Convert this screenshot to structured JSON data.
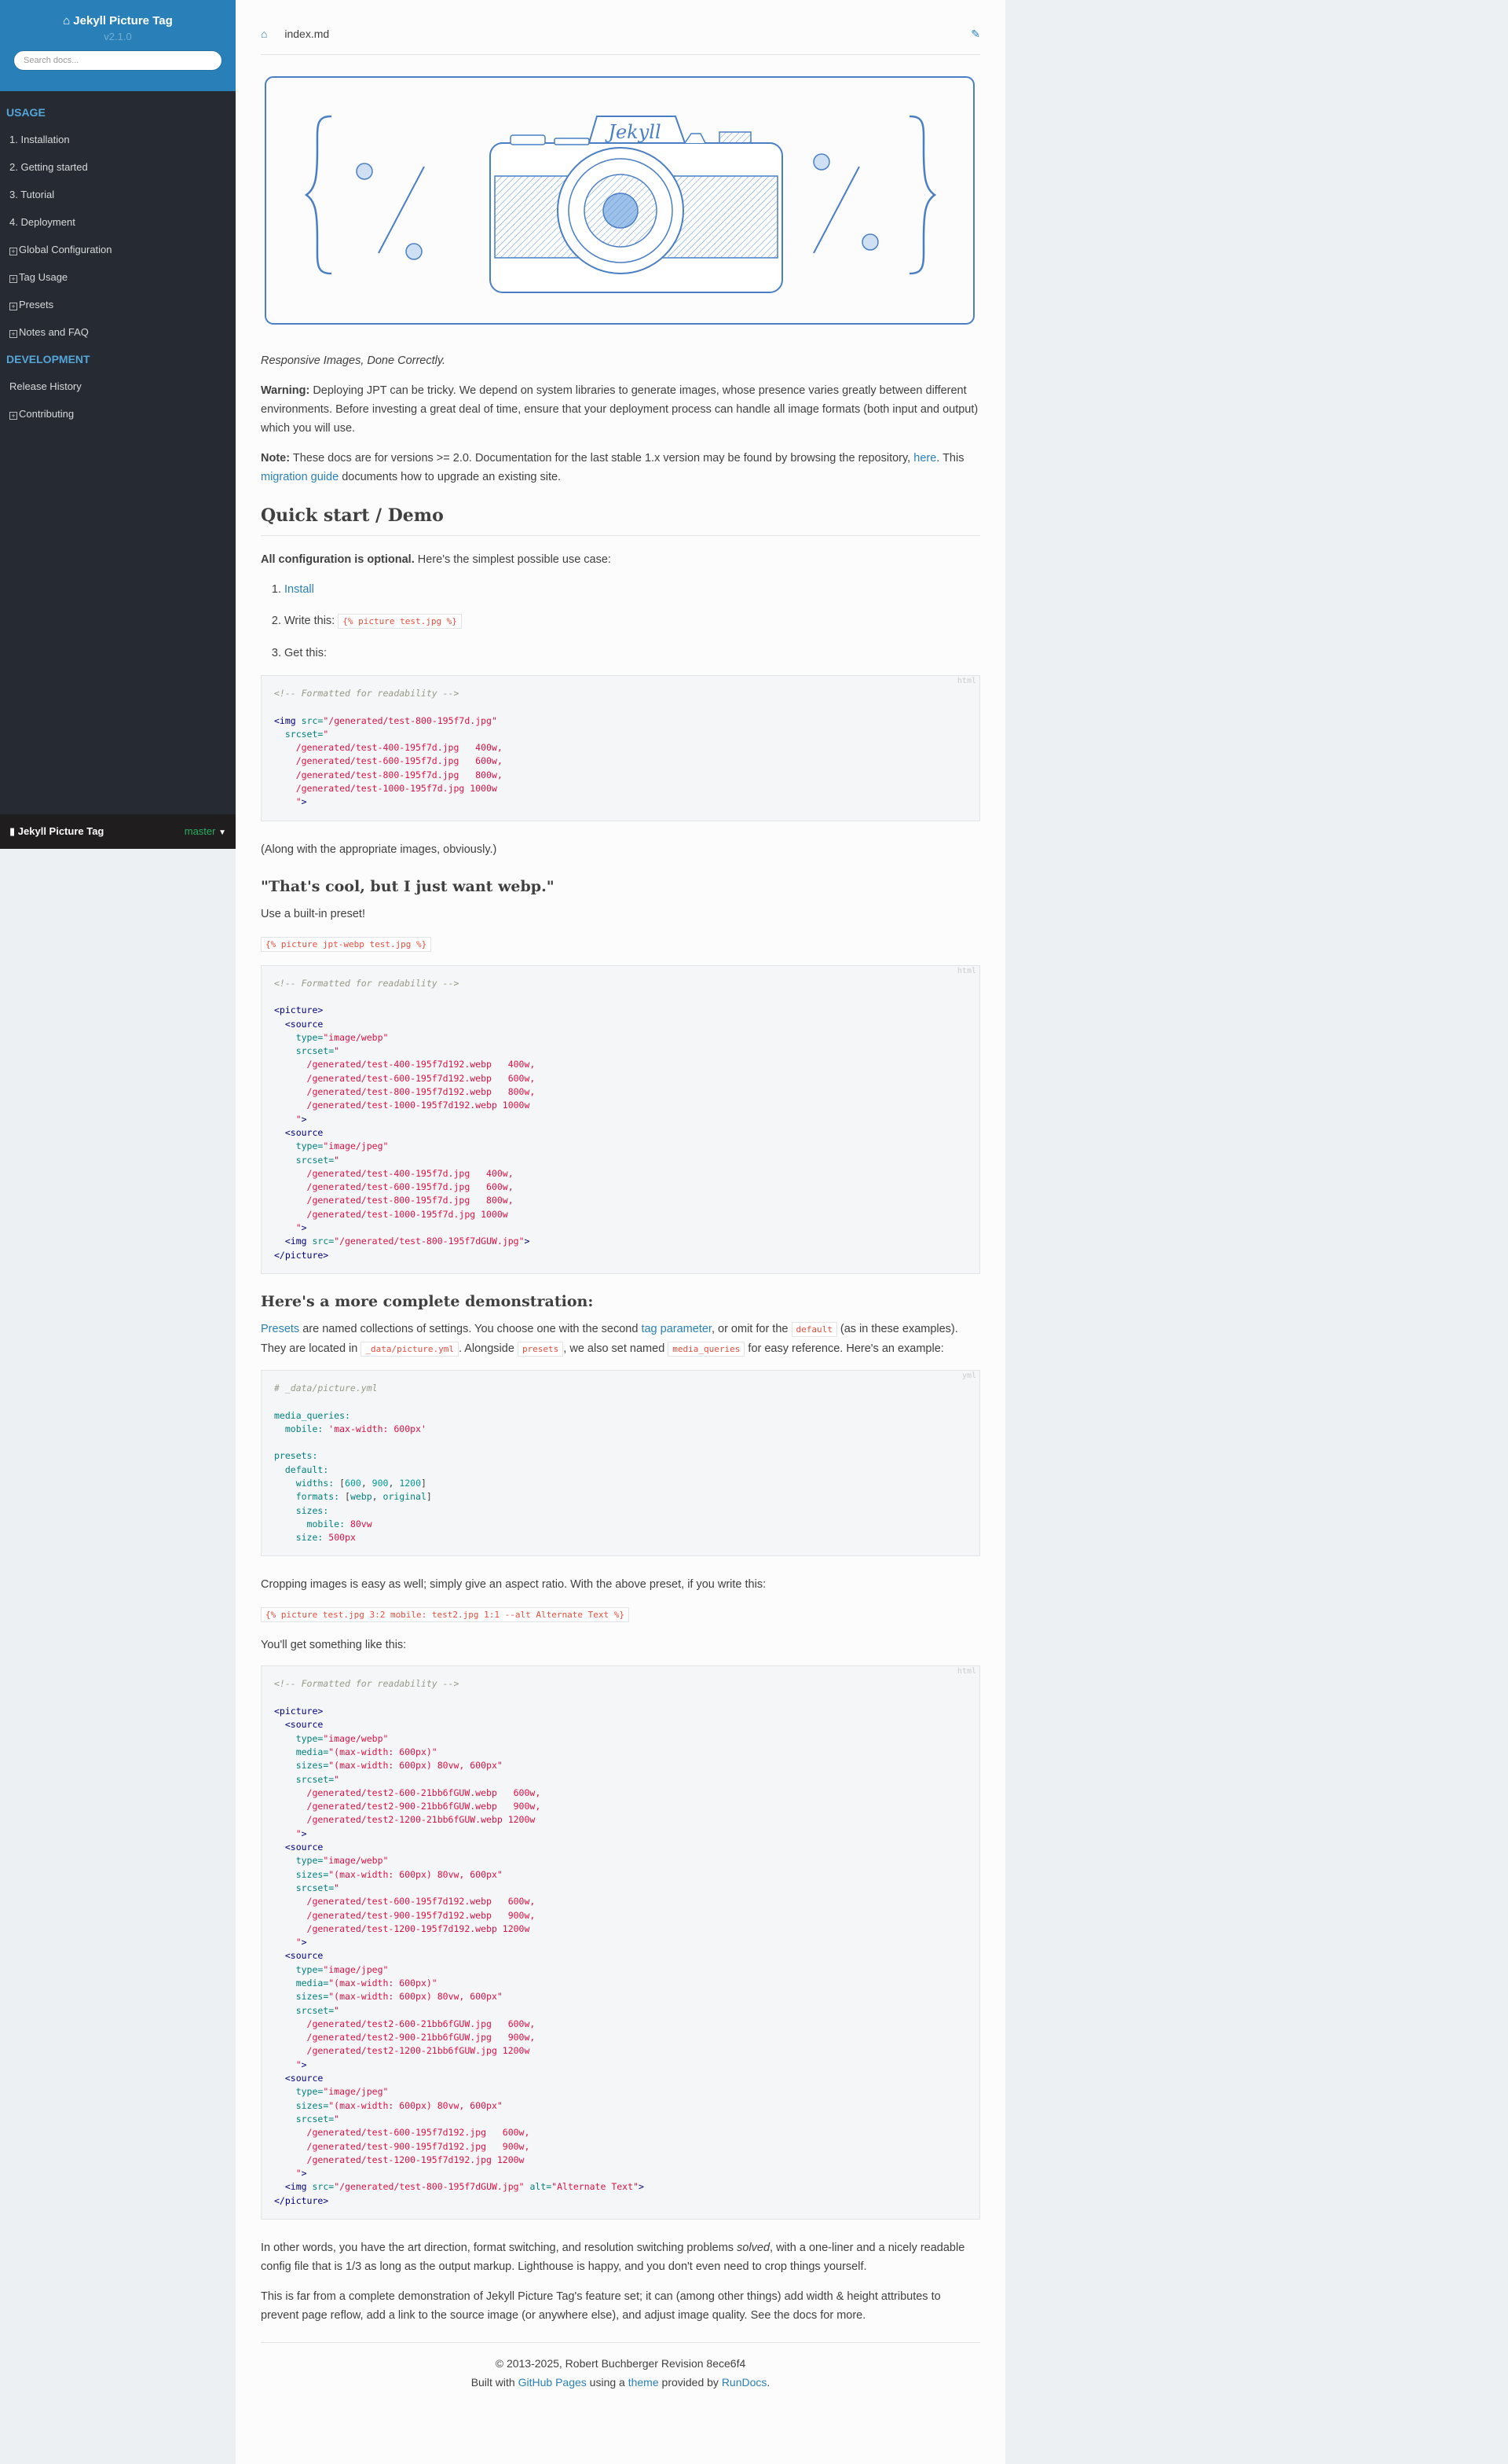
{
  "sidebar": {
    "brand": "Jekyll Picture Tag",
    "version": "v2.1.0",
    "search_placeholder": "Search docs...",
    "caption_usage": "USAGE",
    "usage_items": [
      "1. Installation",
      "2. Getting started",
      "3. Tutorial",
      "4. Deployment"
    ],
    "usage_expandable": [
      "Global Configuration",
      "Tag Usage",
      "Presets",
      "Notes and FAQ"
    ],
    "caption_dev": "DEVELOPMENT",
    "dev_items": [
      "Release History"
    ],
    "dev_expandable": [
      "Contributing"
    ],
    "footer_name": "Jekyll Picture Tag",
    "footer_branch": "master"
  },
  "breadcrumb": {
    "file": "index.md"
  },
  "hero": {
    "label": "Jekyll"
  },
  "intro": {
    "tagline": "Responsive Images, Done Correctly.",
    "warning_label": "Warning:",
    "warning_text": "Deploying JPT can be tricky. We depend on system libraries to generate images, whose presence varies greatly between different environments. Before investing a great deal of time, ensure that your deployment process can handle all image formats (both input and output) which you will use.",
    "note_label": "Note:",
    "note_text": "These docs are for versions >= 2.0. Documentation for the last stable 1.x version may be found by browsing the repository,",
    "note_link": "here",
    "note_text2": ". This",
    "note_link2": "migration guide",
    "note_text3": "documents how to upgrade an existing site."
  },
  "quickstart": {
    "heading": "Quick start / Demo",
    "lead_bold": "All configuration is optional.",
    "lead_text": "Here's the simplest possible use case:",
    "step1_link": "Install",
    "step2_text": "Write this:",
    "step2_code": "{% picture test.jpg %}",
    "step3_text": "Get this:",
    "code_lang": "html",
    "after": "(Along with the appropriate images, obviously.)"
  },
  "webp": {
    "heading": "\"That's cool, but I just want webp.\"",
    "text": "Use a built-in preset!",
    "code": "{% picture jpt-webp test.jpg %}",
    "code_lang": "html"
  },
  "complete": {
    "heading": "Here's a more complete demonstration:",
    "p1_link1": "Presets",
    "p1_text1": "are named collections of settings. You choose one with the second",
    "p1_link2": "tag parameter",
    "p1_text2": ", or omit for the",
    "p1_code1": "default",
    "p1_text3": "(as in these examples). They are located in",
    "p1_code2": "_data/picture.yml",
    "p1_text4": ". Alongside",
    "p1_code3": "presets",
    "p1_text5": ", we also set named",
    "p1_code4": "media_queries",
    "p1_text6": "for easy reference. Here's an example:",
    "yml_lang": "yml",
    "crop_text": "Cropping images is easy as well; simply give an aspect ratio. With the above preset, if you write this:",
    "crop_code": "{% picture test.jpg 3:2 mobile: test2.jpg 1:1 --alt Alternate Text %}",
    "get_text": "You'll get something like this:",
    "html_lang": "html",
    "summary_text1": "In other words, you have the art direction, format switching, and resolution switching problems",
    "summary_em": "solved",
    "summary_text2": ", with a one-liner and a nicely readable config file that is 1/3 as long as the output markup. Lighthouse is happy, and you don't even need to crop things yourself.",
    "final_text": "This is far from a complete demonstration of Jekyll Picture Tag's feature set; it can (among other things) add width & height attributes to prevent page reflow, add a link to the source image (or anywhere else), and adjust image quality. See the docs for more."
  },
  "footer": {
    "copyright": "© 2013-2025, Robert Buchberger Revision 8ece6f4",
    "built_text": "Built with",
    "link1": "GitHub Pages",
    "using": "using a",
    "link2": "theme",
    "provided": "provided by",
    "link3": "RunDocs",
    "end": "."
  },
  "colors": {
    "accent": "#2980b9",
    "sidebar": "#252a33",
    "code_string": "#dd1144"
  },
  "icons": [
    "home-icon",
    "edit-icon",
    "book-icon",
    "expand-icon"
  ]
}
